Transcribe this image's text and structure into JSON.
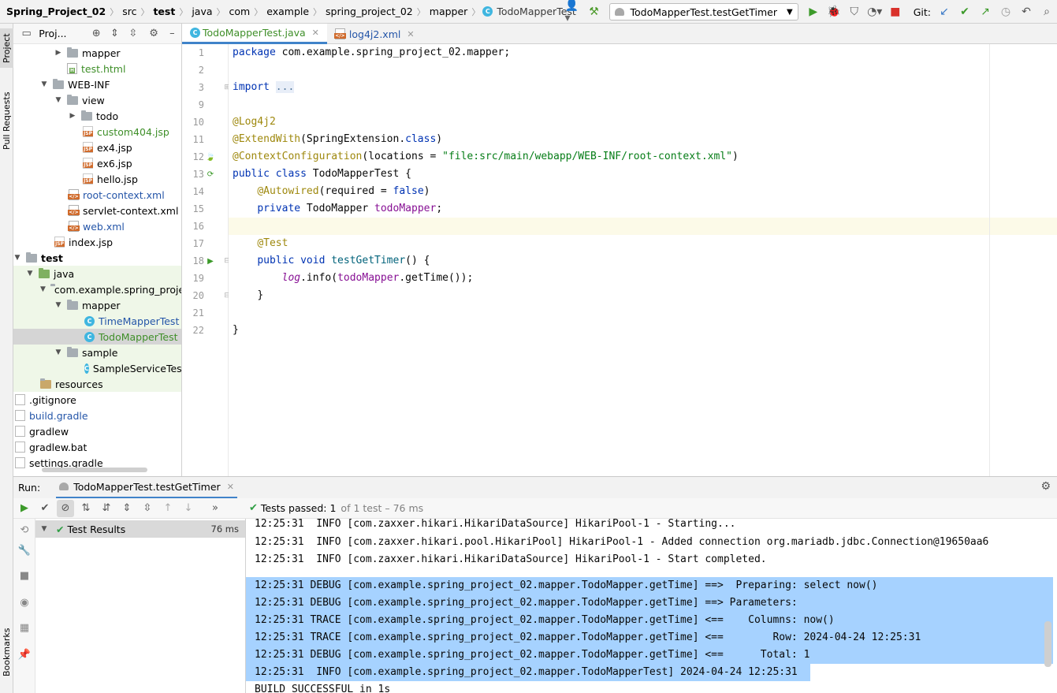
{
  "breadcrumbs": [
    "Spring_Project_02",
    "src",
    "test",
    "java",
    "com",
    "example",
    "spring_project_02",
    "mapper",
    "TodoMapperTest"
  ],
  "run_config": "TodoMapperTest.testGetTimer",
  "git_label": "Git:",
  "side_tabs": {
    "project": "Project",
    "pull_requests": "Pull Requests",
    "bookmarks": "Bookmarks"
  },
  "project_panel": {
    "title": "Proj...",
    "tree": [
      {
        "label": "mapper",
        "icon": "folder",
        "style": ""
      },
      {
        "label": "test.html",
        "icon": "html-file",
        "style": "green"
      },
      {
        "label": "WEB-INF",
        "icon": "folder",
        "style": ""
      },
      {
        "label": "view",
        "icon": "folder",
        "style": ""
      },
      {
        "label": "todo",
        "icon": "folder",
        "style": ""
      },
      {
        "label": "custom404.jsp",
        "icon": "jsp-file",
        "style": "green"
      },
      {
        "label": "ex4.jsp",
        "icon": "jsp-file",
        "style": ""
      },
      {
        "label": "ex6.jsp",
        "icon": "jsp-file",
        "style": ""
      },
      {
        "label": "hello.jsp",
        "icon": "jsp-file",
        "style": ""
      },
      {
        "label": "root-context.xml",
        "icon": "xml-file",
        "style": "blue"
      },
      {
        "label": "servlet-context.xml",
        "icon": "xml-file",
        "style": ""
      },
      {
        "label": "web.xml",
        "icon": "xml-file",
        "style": "blue"
      },
      {
        "label": "index.jsp",
        "icon": "jsp-file",
        "style": ""
      },
      {
        "label": "test",
        "icon": "folder",
        "style": "bold"
      },
      {
        "label": "java",
        "icon": "folder-green",
        "style": ""
      },
      {
        "label": "com.example.spring_projec",
        "icon": "package",
        "style": ""
      },
      {
        "label": "mapper",
        "icon": "package",
        "style": ""
      },
      {
        "label": "TimeMapperTest",
        "icon": "class",
        "style": "blue"
      },
      {
        "label": "TodoMapperTest",
        "icon": "class",
        "style": "green"
      },
      {
        "label": "sample",
        "icon": "package",
        "style": ""
      },
      {
        "label": "SampleServiceTest",
        "icon": "class",
        "style": ""
      },
      {
        "label": "resources",
        "icon": "resources",
        "style": ""
      },
      {
        "label": ".gitignore",
        "icon": "file",
        "style": ""
      },
      {
        "label": "build.gradle",
        "icon": "gradle",
        "style": "blue"
      },
      {
        "label": "gradlew",
        "icon": "file",
        "style": ""
      },
      {
        "label": "gradlew.bat",
        "icon": "file",
        "style": ""
      },
      {
        "label": "settings.gradle",
        "icon": "gradle",
        "style": ""
      }
    ]
  },
  "editor": {
    "tabs": [
      {
        "label": "TodoMapperTest.java",
        "active": true
      },
      {
        "label": "log4j2.xml",
        "active": false
      }
    ],
    "line_numbers": [
      "1",
      "2",
      "3",
      "9",
      "10",
      "11",
      "12",
      "13",
      "14",
      "15",
      "16",
      "17",
      "18",
      "19",
      "20",
      "21",
      "22"
    ],
    "code": {
      "l1_kw": "package",
      "l1_rest": " com.example.spring_project_02.mapper;",
      "l3_kw": "import",
      "l3_fold": "...",
      "l10": "@Log4j2",
      "l11_an": "@ExtendWith",
      "l11_rest": "(SpringExtension.",
      "l11_kw": "class",
      "l11_end": ")",
      "l12_an": "@ContextConfiguration",
      "l12_a": "(locations = ",
      "l12_str": "\"file:src/main/webapp/WEB-INF/root-context.xml\"",
      "l12_end": ")",
      "l13_kw": "public class",
      "l13_rest": " TodoMapperTest {",
      "l14_an": "@Autowired",
      "l14_a": "(required = ",
      "l14_kw": "false",
      "l14_end": ")",
      "l15_kw": "private",
      "l15_a": " TodoMapper ",
      "l15_fld": "todoMapper",
      "l15_end": ";",
      "l17": "@Test",
      "l18_kw": "public void",
      "l18_m": " testGetTimer",
      "l18_end": "() {",
      "l19_log": "log",
      "l19_a": ".info(",
      "l19_fld": "todoMapper",
      "l19_end": ".getTime());",
      "l20": "}",
      "l22": "}"
    }
  },
  "run_panel": {
    "label": "Run:",
    "tab": "TodoMapperTest.testGetTimer",
    "status_text": "Tests passed:",
    "passed_count": "1",
    "status_rest": "of 1 test – 76 ms",
    "results_label": "Test Results",
    "results_time": "76 ms",
    "console": [
      {
        "text": "12:25:31  INFO [com.zaxxer.hikari.HikariDataSource] HikariPool-1 - Starting...",
        "selected": false
      },
      {
        "text": "12:25:31  INFO [com.zaxxer.hikari.pool.HikariPool] HikariPool-1 - Added connection org.mariadb.jdbc.Connection@19650aa6",
        "selected": false
      },
      {
        "text": "12:25:31  INFO [com.zaxxer.hikari.HikariDataSource] HikariPool-1 - Start completed.",
        "selected": false
      },
      {
        "text": "12:25:31 DEBUG [com.example.spring_project_02.mapper.TodoMapper.getTime] ==>  Preparing: select now()",
        "selected": true
      },
      {
        "text": "12:25:31 DEBUG [com.example.spring_project_02.mapper.TodoMapper.getTime] ==> Parameters: ",
        "selected": true
      },
      {
        "text": "12:25:31 TRACE [com.example.spring_project_02.mapper.TodoMapper.getTime] <==    Columns: now()",
        "selected": true
      },
      {
        "text": "12:25:31 TRACE [com.example.spring_project_02.mapper.TodoMapper.getTime] <==        Row: 2024-04-24 12:25:31",
        "selected": true
      },
      {
        "text": "12:25:31 DEBUG [com.example.spring_project_02.mapper.TodoMapper.getTime] <==      Total: 1",
        "selected": true
      },
      {
        "text": "12:25:31  INFO [com.example.spring_project_02.mapper.TodoMapperTest] 2024-04-24 12:25:31",
        "selected": true
      },
      {
        "text": "BUILD SUCCESSFUL in 1s",
        "selected": false
      }
    ]
  },
  "colors": {
    "accent": "#4083c9",
    "test_zone": "#eff7e8",
    "selection": "#a6d2ff",
    "pass": "#2f9e44"
  }
}
